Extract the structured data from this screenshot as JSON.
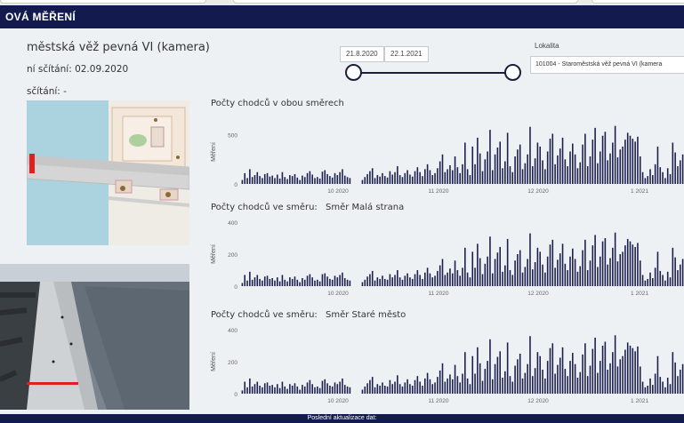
{
  "header": {
    "title": "OVÁ MĚŘENÍ"
  },
  "info": {
    "location_name": "městská věž pevná VI (kamera)",
    "counting_start": "ní sčítání: 02.09.2020",
    "last_counting": "sčítání: -"
  },
  "filters": {
    "date_from": "21.8.2020",
    "date_to": "22.1.2021",
    "lokalita_label": "Lokalita",
    "lokalita_value": "101004 - Staroměstská věž pevná VI (kamera"
  },
  "charts": [
    {
      "title": "Počty chodců v obou směrech",
      "subtitle": "",
      "ylabel": "Měření"
    },
    {
      "title": "Počty chodců ve směru:",
      "subtitle": "Směr Malá strana",
      "ylabel": "Měření"
    },
    {
      "title": "Počty chodců ve směru:",
      "subtitle": "Směr Staré město",
      "ylabel": "Měření"
    }
  ],
  "chart_data": [
    {
      "type": "bar",
      "ylabel": "Měření",
      "ylim": [
        0,
        650
      ],
      "yticks": [
        0,
        500
      ],
      "xticks": [
        "10 2020",
        "11 2020",
        "12 2020",
        "1 2021"
      ],
      "color": "#1b1f4d",
      "values": [
        40,
        110,
        60,
        150,
        70,
        90,
        120,
        80,
        60,
        100,
        110,
        75,
        85,
        60,
        95,
        55,
        120,
        70,
        50,
        90,
        80,
        100,
        65,
        40,
        85,
        70,
        110,
        130,
        95,
        60,
        70,
        55,
        125,
        140,
        100,
        80,
        65,
        110,
        90,
        120,
        150,
        85,
        70,
        60,
        0,
        0,
        0,
        0,
        40,
        70,
        100,
        130,
        160,
        60,
        90,
        75,
        110,
        80,
        65,
        130,
        95,
        120,
        180,
        90,
        70,
        110,
        140,
        95,
        75,
        130,
        170,
        120,
        80,
        150,
        200,
        140,
        90,
        110,
        160,
        230,
        300,
        120,
        150,
        190,
        140,
        280,
        170,
        110,
        200,
        420,
        150,
        90,
        380,
        200,
        470,
        310,
        130,
        250,
        330,
        550,
        140,
        300,
        370,
        430,
        160,
        230,
        520,
        180,
        120,
        280,
        350,
        400,
        150,
        210,
        300,
        580,
        180,
        260,
        420,
        380,
        240,
        150,
        330,
        460,
        510,
        200,
        290,
        360,
        470,
        250,
        180,
        330,
        410,
        300,
        160,
        220,
        400,
        510,
        180,
        280,
        450,
        570,
        210,
        330,
        490,
        530,
        240,
        310,
        420,
        590,
        270,
        350,
        380,
        450,
        520,
        490,
        460,
        430,
        480,
        280,
        120,
        60,
        80,
        150,
        90,
        200,
        380,
        170,
        120,
        60,
        160,
        100,
        420,
        320,
        180,
        240,
        300
      ]
    },
    {
      "type": "bar",
      "ylabel": "Měření",
      "ylim": [
        0,
        400
      ],
      "yticks": [
        0,
        200,
        400
      ],
      "xticks": [
        "10 2020",
        "11 2020",
        "12 2020",
        "1 2021"
      ],
      "color": "#1b1f4d",
      "values": [
        20,
        70,
        35,
        90,
        40,
        55,
        70,
        45,
        35,
        60,
        65,
        45,
        50,
        35,
        55,
        30,
        70,
        40,
        30,
        55,
        45,
        60,
        40,
        25,
        50,
        40,
        65,
        75,
        55,
        35,
        40,
        30,
        75,
        80,
        60,
        45,
        40,
        65,
        55,
        70,
        85,
        50,
        40,
        35,
        0,
        0,
        0,
        0,
        25,
        40,
        60,
        75,
        95,
        35,
        55,
        45,
        65,
        45,
        40,
        75,
        55,
        70,
        100,
        55,
        40,
        65,
        80,
        55,
        45,
        75,
        100,
        70,
        45,
        85,
        115,
        80,
        55,
        65,
        95,
        130,
        170,
        70,
        85,
        110,
        80,
        160,
        100,
        65,
        115,
        240,
        85,
        55,
        215,
        115,
        265,
        175,
        75,
        140,
        185,
        310,
        80,
        170,
        210,
        245,
        90,
        130,
        295,
        100,
        70,
        160,
        200,
        225,
        85,
        120,
        170,
        330,
        105,
        150,
        240,
        215,
        135,
        85,
        185,
        260,
        290,
        115,
        165,
        205,
        265,
        140,
        100,
        185,
        235,
        170,
        90,
        125,
        225,
        290,
        100,
        160,
        255,
        320,
        120,
        185,
        280,
        300,
        135,
        175,
        240,
        335,
        155,
        200,
        215,
        255,
        295,
        280,
        260,
        245,
        270,
        160,
        70,
        35,
        45,
        85,
        50,
        115,
        215,
        95,
        70,
        35,
        90,
        55,
        240,
        180,
        100,
        135,
        170
      ]
    },
    {
      "type": "bar",
      "ylabel": "Měření",
      "ylim": [
        0,
        400
      ],
      "yticks": [
        0,
        200,
        400
      ],
      "xticks": [
        "10 2020",
        "11 2020",
        "12 2020",
        "1 2021"
      ],
      "color": "#1b1f4d",
      "values": [
        20,
        75,
        40,
        95,
        45,
        60,
        75,
        50,
        40,
        65,
        70,
        50,
        55,
        40,
        60,
        35,
        75,
        45,
        30,
        60,
        50,
        65,
        45,
        25,
        55,
        45,
        70,
        85,
        60,
        40,
        45,
        35,
        80,
        90,
        65,
        50,
        45,
        70,
        60,
        75,
        95,
        55,
        45,
        40,
        0,
        0,
        0,
        0,
        25,
        45,
        65,
        85,
        105,
        40,
        60,
        50,
        70,
        50,
        45,
        85,
        60,
        75,
        115,
        60,
        45,
        70,
        90,
        60,
        50,
        85,
        110,
        75,
        50,
        95,
        130,
        90,
        60,
        70,
        105,
        145,
        190,
        75,
        95,
        120,
        90,
        180,
        110,
        70,
        125,
        260,
        95,
        60,
        235,
        125,
        290,
        190,
        80,
        155,
        205,
        340,
        90,
        185,
        230,
        265,
        100,
        140,
        320,
        110,
        75,
        175,
        215,
        250,
        95,
        130,
        185,
        360,
        110,
        160,
        260,
        235,
        150,
        95,
        205,
        285,
        315,
        125,
        180,
        225,
        290,
        155,
        110,
        205,
        255,
        185,
        100,
        135,
        245,
        315,
        110,
        175,
        280,
        350,
        130,
        205,
        300,
        325,
        150,
        190,
        260,
        365,
        170,
        215,
        235,
        275,
        320,
        300,
        285,
        265,
        295,
        170,
        75,
        40,
        50,
        95,
        55,
        125,
        235,
        105,
        75,
        40,
        100,
        60,
        260,
        195,
        110,
        150,
        185
      ]
    }
  ],
  "footer": {
    "text": "Poslední aktualizace dat:"
  }
}
